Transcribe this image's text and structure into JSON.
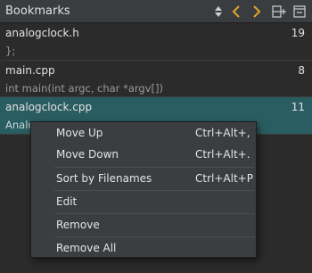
{
  "panel": {
    "title": "Bookmarks",
    "icons": [
      "sort-arrows-icon",
      "previous-chevron-icon",
      "next-chevron-icon",
      "split-add-icon",
      "close-panel-icon"
    ],
    "accent": "#e0a52a"
  },
  "bookmarks": [
    {
      "file": "analogclock.h",
      "line": "19",
      "snippet": "};"
    },
    {
      "file": "main.cpp",
      "line": "8",
      "snippet": "int main(int argc, char *argv[])"
    },
    {
      "file": "analogclock.cpp",
      "line": "11",
      "snippet": "Analo"
    }
  ],
  "colors": {
    "selected_row": "#2a5d61"
  },
  "context_menu": {
    "move_up": {
      "label": "Move Up",
      "shortcut": "Ctrl+Alt+,"
    },
    "move_down": {
      "label": "Move Down",
      "shortcut": "Ctrl+Alt+."
    },
    "sort": {
      "label": "Sort by Filenames",
      "shortcut": "Ctrl+Alt+P"
    },
    "edit": {
      "label": "Edit"
    },
    "remove": {
      "label": "Remove"
    },
    "remove_all": {
      "label": "Remove All"
    }
  }
}
